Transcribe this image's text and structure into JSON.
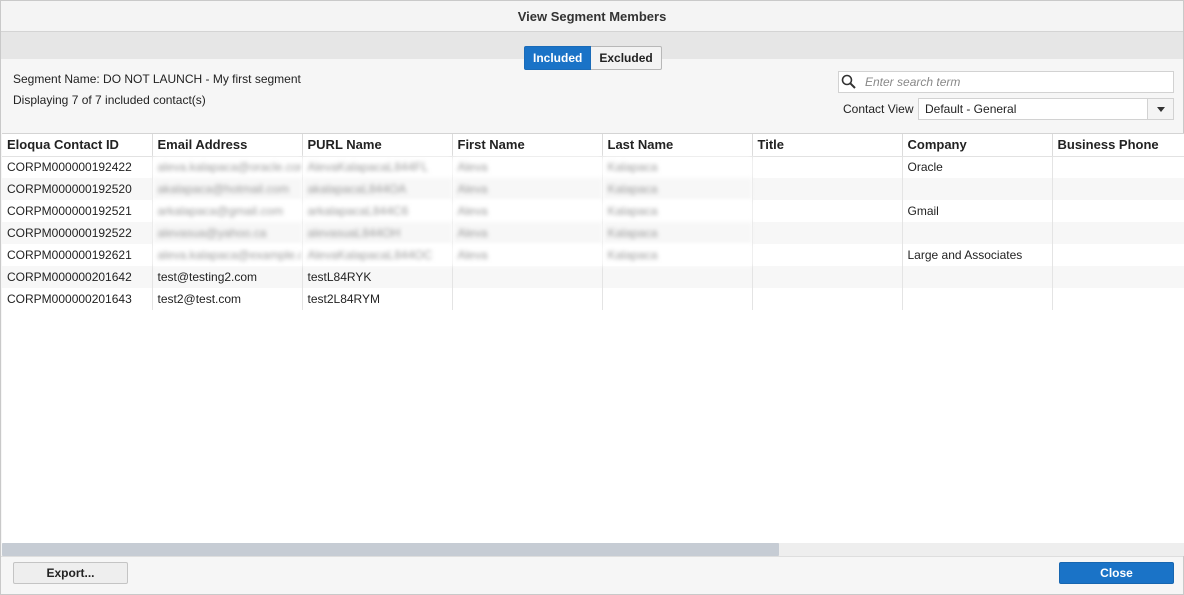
{
  "dialog": {
    "title": "View Segment Members"
  },
  "tabs": [
    {
      "label": "Included",
      "active": true
    },
    {
      "label": "Excluded",
      "active": false
    }
  ],
  "segment_name_text": "Segment Name: DO NOT LAUNCH - My first segment",
  "displaying_text": "Displaying 7 of 7 included contact(s)",
  "search": {
    "placeholder": "Enter search term",
    "value": ""
  },
  "contact_view": {
    "label": "Contact View",
    "selected": "Default - General"
  },
  "table": {
    "columns": [
      "Eloqua Contact ID",
      "Email Address",
      "PURL Name",
      "First Name",
      "Last Name",
      "Title",
      "Company",
      "Business Phone"
    ],
    "rows": [
      {
        "id": "CORPM000000192422",
        "email": "aleva.kalapaca@oracle.com",
        "purl": "AlevaKalapacaL844FL",
        "first": "Aleva",
        "last": "Kalapaca",
        "title": "",
        "company": "Oracle",
        "phone": ""
      },
      {
        "id": "CORPM000000192520",
        "email": "akalapaca@hotmail.com",
        "purl": "akalapacaL844OA",
        "first": "Aleva",
        "last": "Kalapaca",
        "title": "",
        "company": "",
        "phone": ""
      },
      {
        "id": "CORPM000000192521",
        "email": "arkalapaca@gmail.com",
        "purl": "arkalapacaL844C6",
        "first": "Aleva",
        "last": "Kalapaca",
        "title": "",
        "company": "Gmail",
        "phone": ""
      },
      {
        "id": "CORPM000000192522",
        "email": "alevasua@yahoo.ca",
        "purl": "alevasuaL844OH",
        "first": "Aleva",
        "last": "Kalapaca",
        "title": "",
        "company": "",
        "phone": ""
      },
      {
        "id": "CORPM000000192621",
        "email": "aleva.kalapaca@example.com",
        "purl": "AlevaKalapacaL844OC",
        "first": "Aleva",
        "last": "Kalapaca",
        "title": "",
        "company": "Large and Associates",
        "phone": ""
      },
      {
        "id": "CORPM000000201642",
        "email": "test@testing2.com",
        "purl": "testL84RYK",
        "first": "",
        "last": "",
        "title": "",
        "company": "",
        "phone": ""
      },
      {
        "id": "CORPM000000201643",
        "email": "test2@test.com",
        "purl": "test2L84RYM",
        "first": "",
        "last": "",
        "title": "",
        "company": "",
        "phone": ""
      }
    ],
    "blurred_rows": 5,
    "horizontal_scroll_visible_fraction": 0.66
  },
  "footer": {
    "export_label": "Export...",
    "close_label": "Close"
  },
  "colors": {
    "accent": "#1a73c7",
    "tab_band": "#e6e6e6",
    "row_alt": "#f7f7f7"
  },
  "icons": {
    "search": "search-icon",
    "dropdown": "chevron-down-icon"
  }
}
